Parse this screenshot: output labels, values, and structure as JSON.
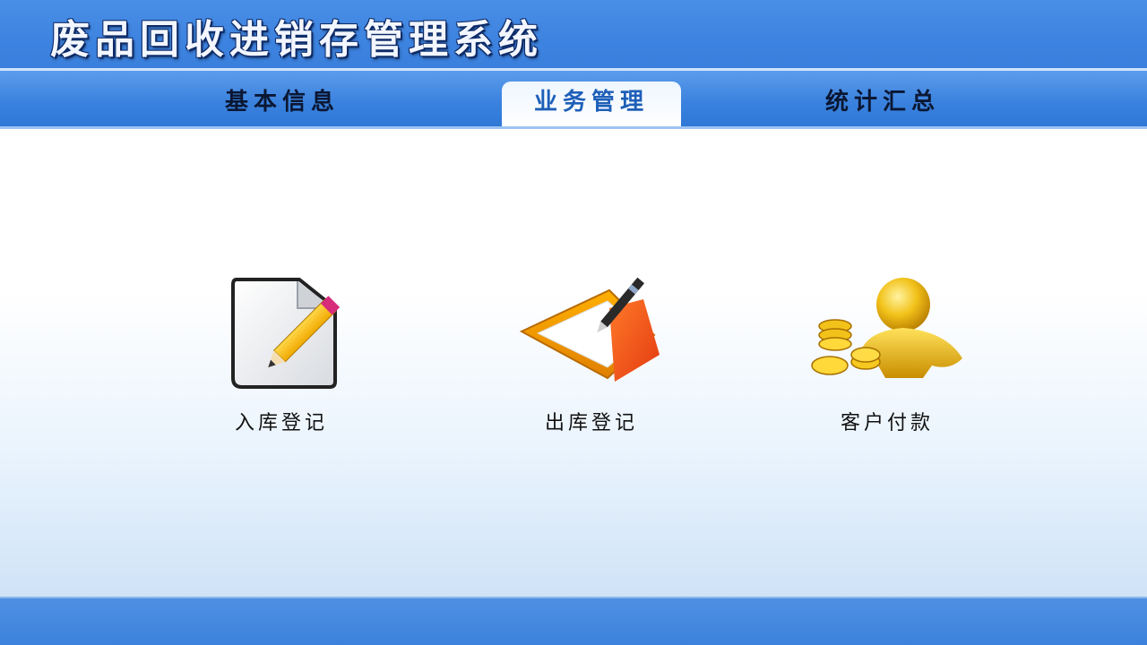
{
  "app": {
    "title": "废品回收进销存管理系统"
  },
  "tabs": [
    {
      "label": "基本信息",
      "active": false
    },
    {
      "label": "业务管理",
      "active": true
    },
    {
      "label": "统计汇总",
      "active": false
    }
  ],
  "features": [
    {
      "label": "入库登记",
      "icon": "edit-document-icon"
    },
    {
      "label": "出库登记",
      "icon": "folder-pen-icon"
    },
    {
      "label": "客户付款",
      "icon": "customer-coins-icon"
    }
  ],
  "colors": {
    "header_blue": "#3d83e0",
    "active_tab_text": "#1e5fb8",
    "footer_blue": "#3b82dd"
  }
}
